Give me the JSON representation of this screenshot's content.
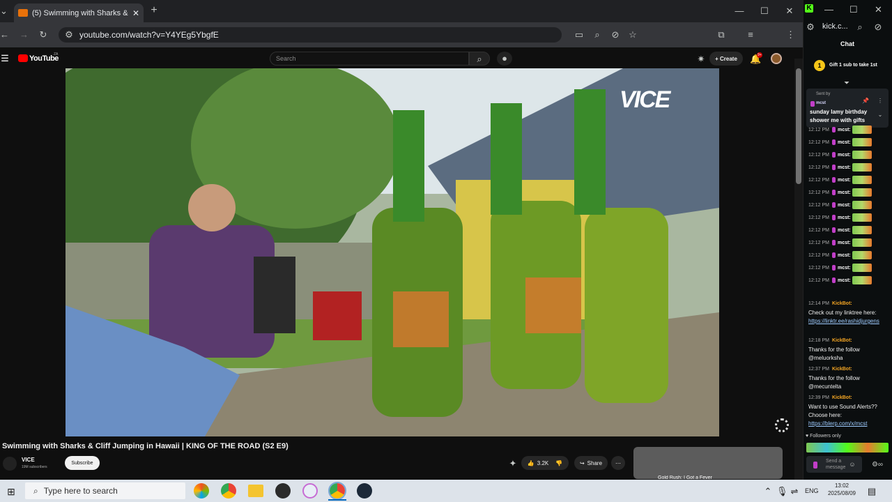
{
  "browser": {
    "tab_title": "(5) Swimming with Sharks &",
    "url": "youtube.com/watch?v=Y4YEg5YbgfE",
    "new_tab": "+"
  },
  "youtube": {
    "logo": "YouTube",
    "logo_sup": "ZA",
    "search_placeholder": "Search",
    "create_label": "+ Create",
    "notifications_badge": "9+",
    "video_title": "Swimming with Sharks & Cliff Jumping in Hawaii | KING OF THE ROAD (S2 E9)",
    "channel_name": "VICE",
    "subscribers": "19M subscribers",
    "subscribe_label": "Subscribe",
    "like_count": "3.2K",
    "share_label": "Share",
    "overlay_logo": "VICE",
    "next_video_partial": "Gold Rush: I Got a Fever"
  },
  "kick": {
    "site": "kick.c...",
    "chat_header": "Chat",
    "gift_text": "Gift 1 sub to take 1st",
    "pinned_sent_by": "Sent by",
    "pinned_user": "mcst",
    "pinned_text": "sunday lamy birthday shower me with gifts",
    "messages": [
      {
        "ts": "12:12 PM",
        "user": "mcst:"
      },
      {
        "ts": "12:12 PM",
        "user": "mcst:"
      },
      {
        "ts": "12:12 PM",
        "user": "mcst:"
      },
      {
        "ts": "12:12 PM",
        "user": "mcst:"
      },
      {
        "ts": "12:12 PM",
        "user": "mcst:"
      },
      {
        "ts": "12:12 PM",
        "user": "mcst:"
      },
      {
        "ts": "12:12 PM",
        "user": "mcst:"
      },
      {
        "ts": "12:12 PM",
        "user": "mcst:"
      },
      {
        "ts": "12:12 PM",
        "user": "mcst:"
      },
      {
        "ts": "12:12 PM",
        "user": "mcst:"
      },
      {
        "ts": "12:12 PM",
        "user": "mcst:"
      },
      {
        "ts": "12:12 PM",
        "user": "mcst:"
      },
      {
        "ts": "12:12 PM",
        "user": "mcst:"
      }
    ],
    "bot_messages": [
      {
        "ts": "12:14 PM",
        "user": "KickBot:",
        "text": "Check out my linktree here:",
        "link": "https://linktr.ee/rashidjurgens"
      },
      {
        "ts": "12:18 PM",
        "user": "KickBot:",
        "text": "Thanks for the follow @meluorksha",
        "link": ""
      },
      {
        "ts": "12:37 PM",
        "user": "KickBot:",
        "text": "Thanks for the follow @mecuntelta",
        "link": ""
      },
      {
        "ts": "12:39 PM",
        "user": "KickBot:",
        "text": "Want to use Sound Alerts?? Choose here:",
        "link": "https://blerp.com/x/mcst"
      }
    ],
    "followers_only": "Followers only",
    "send_placeholder": "Send a message"
  },
  "taskbar": {
    "search_placeholder": "Type here to search",
    "lang": "ENG",
    "time": "13:02",
    "date": "2025/08/09"
  },
  "colors": {
    "yt_red": "#ff0000",
    "kick_green": "#53fc18",
    "kick_bot": "#f5a623"
  }
}
